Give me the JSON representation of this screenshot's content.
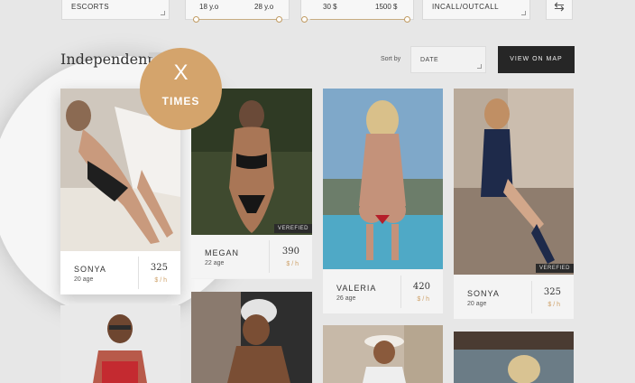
{
  "filters": {
    "category": "ESCORTS",
    "age_min": "18 y.o",
    "age_max": "28 y.o",
    "price_min": "30 $",
    "price_max": "1500 $",
    "service": "INCALL/OUTCALL",
    "swap_icon": "sliders-icon"
  },
  "section": {
    "title": "Independent"
  },
  "sort": {
    "label": "Sort by",
    "value": "DATE"
  },
  "map_button": "VIEW ON MAP",
  "promo": {
    "letter": "X",
    "word": "TIMES"
  },
  "cards": [
    {
      "name": "SONYA",
      "age": "20 age",
      "price": "325",
      "per": "$ / h",
      "verified": ""
    },
    {
      "name": "MEGAN",
      "age": "22 age",
      "price": "390",
      "per": "$ / h",
      "verified": "VEREFIED"
    },
    {
      "name": "VALERIA",
      "age": "26 age",
      "price": "420",
      "per": "$ / h",
      "verified": ""
    },
    {
      "name": "SONYA",
      "age": "20 age",
      "price": "325",
      "per": "$ / h",
      "verified": "VEREFIED"
    }
  ],
  "colors": {
    "accent": "#d4a46c",
    "dark_button": "#262626",
    "background": "#e7e7e7"
  }
}
